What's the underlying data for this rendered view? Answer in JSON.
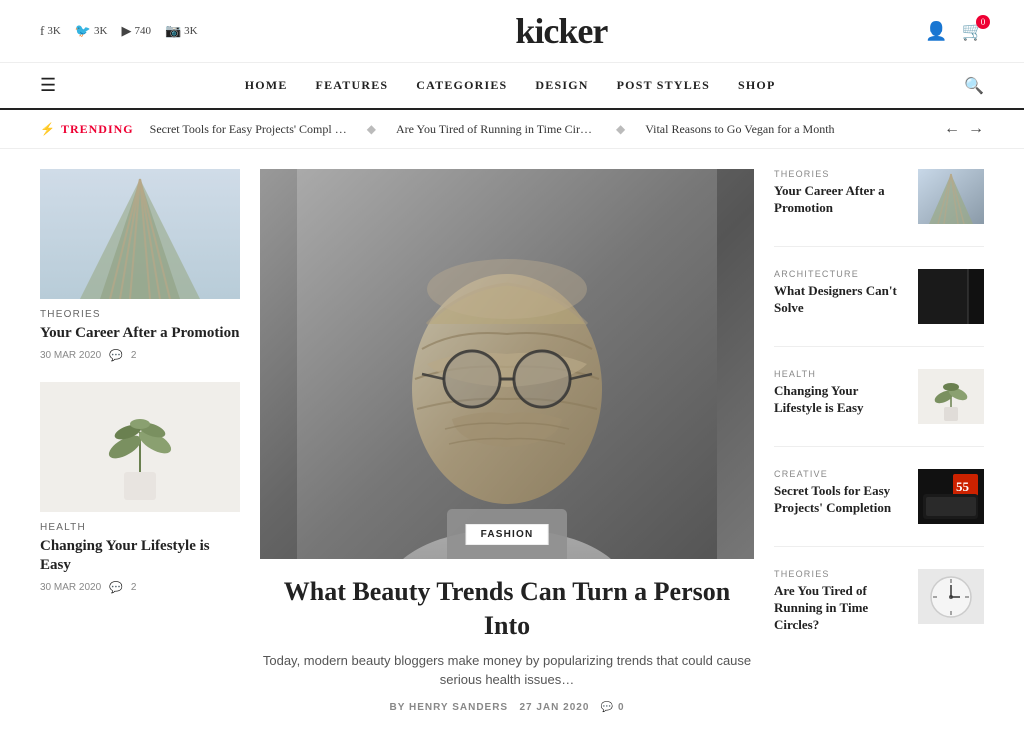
{
  "site": {
    "title": "kicker"
  },
  "social": [
    {
      "icon": "f",
      "label": "f",
      "count": "3K"
    },
    {
      "icon": "🐦",
      "label": "🐦",
      "count": "3K"
    },
    {
      "icon": "▶",
      "label": "▶",
      "count": "740"
    },
    {
      "icon": "📷",
      "label": "📷",
      "count": "3K"
    }
  ],
  "nav": {
    "hamburger": "☰",
    "items": [
      "HOME",
      "FEATURES",
      "CATEGORIES",
      "DESIGN",
      "POST STYLES",
      "SHOP"
    ],
    "search": "🔍"
  },
  "trending": {
    "label": "TRENDING",
    "bolt": "⚡",
    "items": [
      "Secret Tools for Easy Projects' Compl …",
      "Are You Tired of Running in Time Circl…",
      "Vital Reasons to Go Vegan for a Month"
    ],
    "prev": "←",
    "next": "→"
  },
  "left_cards": [
    {
      "category": "THEORIES",
      "title": "Your Career After a Promotion",
      "date": "30 MAR 2020",
      "comments": "2"
    },
    {
      "category": "HEALTH",
      "title": "Changing Your Lifestyle is Easy",
      "date": "30 MAR 2020",
      "comments": "2"
    }
  ],
  "featured": {
    "category": "FASHION",
    "title": "What Beauty Trends Can Turn a Person Into",
    "excerpt": "Today, modern beauty bloggers make money by popularizing trends that could cause serious health issues…",
    "by_label": "BY",
    "author": "HENRY SANDERS",
    "date": "27 JAN 2020",
    "comments": "0"
  },
  "right_items": [
    {
      "category": "THEORIES",
      "title": "Your Career After a Promotion",
      "img_type": "building"
    },
    {
      "category": "ARCHITECTURE",
      "title": "What Designers Can't Solve",
      "img_type": "dark"
    },
    {
      "category": "HEALTH",
      "title": "Changing Your Lifestyle is Easy",
      "img_type": "plant"
    },
    {
      "category": "CREATIVE",
      "title": "Secret Tools for Easy Projects' Completion",
      "img_type": "tools"
    },
    {
      "category": "THEORIES",
      "title": "Are You Tired of Running in Time Circles?",
      "img_type": "clock"
    }
  ],
  "cart_count": "0"
}
